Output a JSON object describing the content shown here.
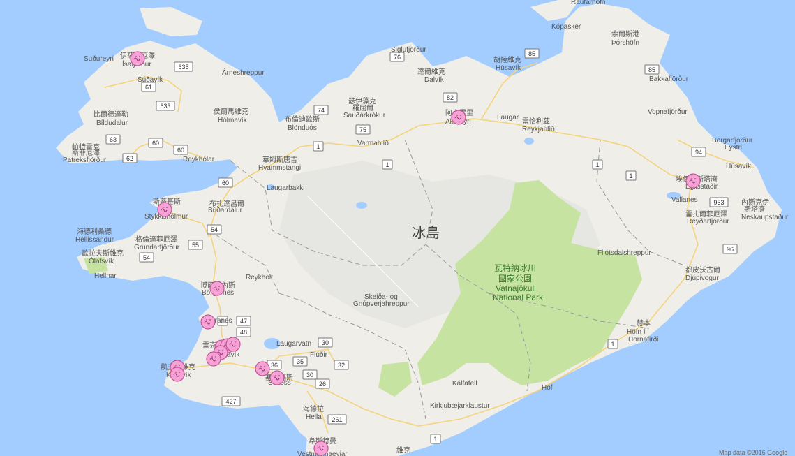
{
  "map": {
    "country_label": "冰島",
    "ocean_color": "#a3ccff",
    "land_color": "#efeee9",
    "park_color": "#c6e3a2",
    "highland_color": "#e1e1e1"
  },
  "places": [
    {
      "id": "raufarhofn",
      "text": "Raufarhöfn"
    },
    {
      "id": "kopasker",
      "text": "Kópasker"
    },
    {
      "id": "thorshofn-zh",
      "text": "索爾斯港"
    },
    {
      "id": "thorshofn",
      "text": "Þórshöfn"
    },
    {
      "id": "sudureyri",
      "text": "Suðureyri"
    },
    {
      "id": "isafjordur-zh",
      "text": "伊薩菲厄澤"
    },
    {
      "id": "isafjordur",
      "text": "Ísafjörður"
    },
    {
      "id": "sudavik",
      "text": "Súðavík"
    },
    {
      "id": "arneshreppur",
      "text": "Árneshreppur"
    },
    {
      "id": "bildudalur-zh",
      "text": "比爾德達勒"
    },
    {
      "id": "bildudalur",
      "text": "Bíldudalur"
    },
    {
      "id": "holmavik-zh",
      "text": "侯爾馬維克"
    },
    {
      "id": "holmavik",
      "text": "Hólmavík"
    },
    {
      "id": "patreksfjordur-zh1",
      "text": "帕特雷克"
    },
    {
      "id": "patreksfjordur-zh2",
      "text": "斯菲厄澤"
    },
    {
      "id": "patreksfjordur",
      "text": "Patreksfjörður"
    },
    {
      "id": "reykholar",
      "text": "Reykhólar"
    },
    {
      "id": "siglufjordur",
      "text": "Siglufjörður"
    },
    {
      "id": "dalvik-zh",
      "text": "達爾維克"
    },
    {
      "id": "dalvik",
      "text": "Dalvík"
    },
    {
      "id": "husavik-zh",
      "text": "胡薩維克"
    },
    {
      "id": "husavik",
      "text": "Húsavík"
    },
    {
      "id": "saudarkrokur-zh1",
      "text": "瑟伊藻克"
    },
    {
      "id": "saudarkrokur-zh2",
      "text": "羅屈爾"
    },
    {
      "id": "saudarkrokur",
      "text": "Sauðárkrókur"
    },
    {
      "id": "akureyri-zh",
      "text": "阿克雷里"
    },
    {
      "id": "akureyri",
      "text": "Akureyri"
    },
    {
      "id": "laugar",
      "text": "Laugar"
    },
    {
      "id": "reykjahlid-zh",
      "text": "雷恰利茲"
    },
    {
      "id": "reykjahlid",
      "text": "Reykjahlíð"
    },
    {
      "id": "bakkafjordur",
      "text": "Bakkafjörður"
    },
    {
      "id": "vopnafjordur",
      "text": "Vopnafjörður"
    },
    {
      "id": "blonduos-zh",
      "text": "布倫迪歐斯"
    },
    {
      "id": "blonduos",
      "text": "Blönduós"
    },
    {
      "id": "varmahlid",
      "text": "Varmahlíð"
    },
    {
      "id": "hvammstangi-zh",
      "text": "華姆斯唐吉"
    },
    {
      "id": "hvammstangi",
      "text": "Hvammstangi"
    },
    {
      "id": "borgarfjordur",
      "text": "Borgarfjörður"
    },
    {
      "id": "eystri",
      "text": "Eystri"
    },
    {
      "id": "husavik-e",
      "text": "Húsavík"
    },
    {
      "id": "laugarbakki",
      "text": "Laugarbakki"
    },
    {
      "id": "egilsstadir-zh",
      "text": "埃伊爾斯塔濟"
    },
    {
      "id": "egilsstadir",
      "text": "Egilsstaðir"
    },
    {
      "id": "stykkisholmur-zh",
      "text": "斯蒂基斯"
    },
    {
      "id": "stykkisholmur",
      "text": "Stykkishólmur"
    },
    {
      "id": "budardalur-zh",
      "text": "布扎達呂爾"
    },
    {
      "id": "budardalur",
      "text": "Búðardalur"
    },
    {
      "id": "vallanes",
      "text": "Vallanes"
    },
    {
      "id": "neskaupstadur-zh1",
      "text": "內斯克伊"
    },
    {
      "id": "neskaupstadur-zh2",
      "text": "斯塔濟"
    },
    {
      "id": "neskaupstadur",
      "text": "Neskaupstaður"
    },
    {
      "id": "reydarfjordur-zh",
      "text": "雷扎爾菲厄澤"
    },
    {
      "id": "reydarfjordur",
      "text": "Reyðarfjörður"
    },
    {
      "id": "hellissandur-zh",
      "text": "海德利桑德"
    },
    {
      "id": "hellissandur",
      "text": "Hellissandur"
    },
    {
      "id": "grundarfjordur-zh",
      "text": "格倫達菲厄澤"
    },
    {
      "id": "grundarfjordur",
      "text": "Grundarfjörður"
    },
    {
      "id": "olafsvik-zh",
      "text": "歐拉夫斯維克"
    },
    {
      "id": "olafsvik",
      "text": "Ólafsvík"
    },
    {
      "id": "hellnar",
      "text": "Hellnar"
    },
    {
      "id": "fljotsdalshreppur",
      "text": "Fljótsdalshreppur"
    },
    {
      "id": "reykholt",
      "text": "Reykholt"
    },
    {
      "id": "djupivogur-zh",
      "text": "都皮沃古爾"
    },
    {
      "id": "djupivogur",
      "text": "Djúpivogur"
    },
    {
      "id": "borgarnes-zh",
      "text": "博爾加內斯"
    },
    {
      "id": "borgarnes",
      "text": "Borgarnes"
    },
    {
      "id": "skeida",
      "text": "Skeiða- og"
    },
    {
      "id": "gnupverjahreppur",
      "text": "Gnúpverjahreppur"
    },
    {
      "id": "akranes",
      "text": "Akranes"
    },
    {
      "id": "hofn-zh",
      "text": "赫本"
    },
    {
      "id": "hofn",
      "text": "Höfn í"
    },
    {
      "id": "hornafirdi",
      "text": "Hornafirði"
    },
    {
      "id": "reykjavik-zh",
      "text": "雷克雅維克"
    },
    {
      "id": "reykjavik",
      "text": "Reykjavík"
    },
    {
      "id": "laugarvatn",
      "text": "Laugarvatn"
    },
    {
      "id": "fludir",
      "text": "Flúðir"
    },
    {
      "id": "keflavik-zh",
      "text": "凱夫拉維克"
    },
    {
      "id": "keflavik",
      "text": "Keflavík"
    },
    {
      "id": "selfoss-zh",
      "text": "塞爾福斯"
    },
    {
      "id": "selfoss",
      "text": "Selfoss"
    },
    {
      "id": "kalfafell",
      "text": "Kálfafell"
    },
    {
      "id": "hof",
      "text": "Hof"
    },
    {
      "id": "kirkjubaejarklaustur",
      "text": "Kirkjubæjarklaustur"
    },
    {
      "id": "hella-zh",
      "text": "海德拉"
    },
    {
      "id": "hella",
      "text": "Hella"
    },
    {
      "id": "vestmannaeyjar-zh",
      "text": "韋斯特曼"
    },
    {
      "id": "vestmannaeyjar",
      "text": "Vestmannaeyjar"
    },
    {
      "id": "vik-zh",
      "text": "維克"
    }
  ],
  "park": {
    "zh1": "瓦特納冰川",
    "zh2": "國家公園",
    "en1": "Vatnajökull",
    "en2": "National Park"
  },
  "roads": [
    "85",
    "76",
    "635",
    "61",
    "82",
    "85",
    "633",
    "74",
    "75",
    "63",
    "60",
    "60",
    "1",
    "62",
    "94",
    "1",
    "1",
    "1",
    "60",
    "953",
    "54",
    "55",
    "96",
    "54",
    "47",
    "1",
    "48",
    "30",
    "36",
    "35",
    "32",
    "30",
    "26",
    "427",
    "261",
    "1",
    "1"
  ],
  "markers_count": 16,
  "footer": {
    "attribution": "Map data ©2016 Google"
  }
}
